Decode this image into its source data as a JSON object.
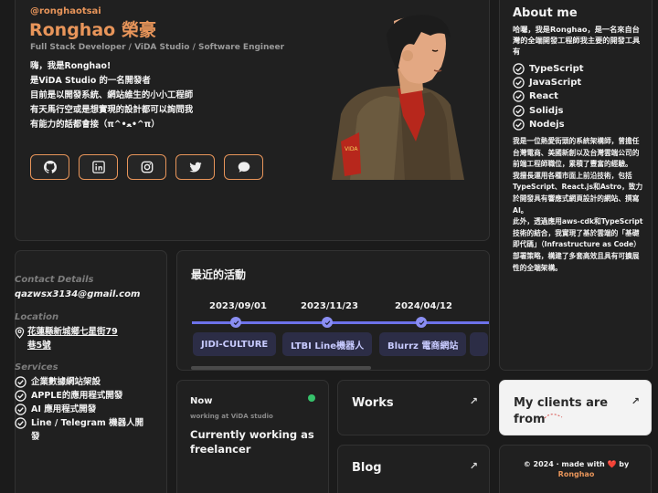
{
  "profile": {
    "handle": "@ronghaotsai",
    "name": "Ronghao 榮豪",
    "role": "Full Stack Developer / ViDA Studio / Software Engineer",
    "bio": [
      "嗨，我是Ronghao!",
      "是ViDA Studio 的一名開發者",
      "目前是以開發系統、網站維生的小小工程師",
      "有天馬行空或是想實現的設計都可以詢問我",
      "有能力的話都會接（π^•ﻌ•^π）"
    ],
    "socials": [
      {
        "icon": "github-icon"
      },
      {
        "icon": "linkedin-icon"
      },
      {
        "icon": "instagram-icon"
      },
      {
        "icon": "twitter-icon"
      },
      {
        "icon": "chat-icon"
      }
    ]
  },
  "about": {
    "title": "About me",
    "intro": "哈囉，我是Ronghao，是一名來自台灣的全端開發工程師我主要的開發工具有",
    "tech": [
      "TypeScript",
      "JavaScript",
      "React",
      "Solidjs",
      "Nodejs"
    ],
    "body": [
      "我是一位熱愛街頭的系統架構師，曾擔任台灣電商、美國新創以及台灣雲端公司的前端工程師職位，累積了豐富的經驗。",
      "我擅長運用各種市面上前沿技術，包括TypeScript、React.js和Astro，致力於開發具有響應式網頁設計的網站、撰寫AI。",
      "此外，透過應用aws-cdk和TypeScript技術的結合，我實現了基於雲端的「基礎即代碼」（Infrastructure as Code）部署策略，構建了多套高效且具有可擴展性的全端架構。"
    ]
  },
  "contact": {
    "details_label": "Contact Details",
    "email": "qazwsx3134@gmail.com",
    "location_label": "Location",
    "address": "花蓮縣新城鄉七星街79巷5號",
    "services_label": "Services",
    "services": [
      "企業數據網站架設",
      "APPLE的應用程式開發",
      "AI 應用程式開發",
      "Line / Telegram 機器人開發"
    ]
  },
  "activity": {
    "title": "最近的活動",
    "items": [
      {
        "date": "2023/09/01",
        "tag": "JIDI-CULTURE"
      },
      {
        "date": "2023/11/23",
        "tag": "LTBI Line機器人"
      },
      {
        "date": "2024/04/12",
        "tag": "Blurrz 電商網站"
      }
    ]
  },
  "now": {
    "title": "Now",
    "subtitle": "working at ViDA studio",
    "status": "Currently working as freelancer"
  },
  "links": {
    "works": "Works",
    "blog": "Blog",
    "clients": "My clients are from",
    "arrow": "↗"
  },
  "footer": {
    "line1": "© 2024 · made with ❤️ by",
    "author": "Ronghao"
  },
  "colors": {
    "accent": "#e8955a",
    "timeline": "#6d72e9",
    "online": "#36c26b"
  }
}
